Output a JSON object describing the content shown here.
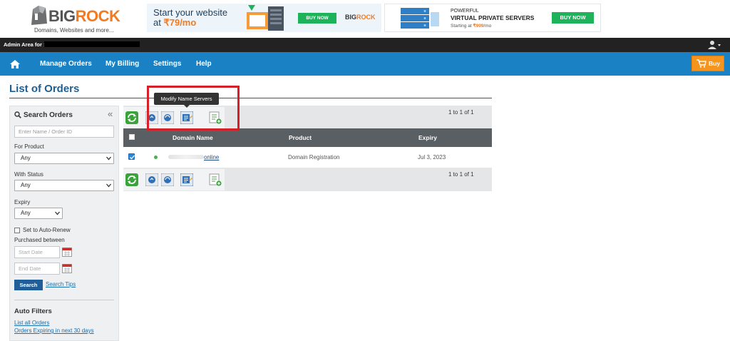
{
  "header": {
    "brand_big": "BIG",
    "brand_rock": "ROCK",
    "tagline": "Domains, Websites and more...",
    "ad1": {
      "line1": "Start your website",
      "line2_prefix": "at ",
      "price": "₹79/mo",
      "button": "BUY NOW",
      "brand_big": "BIG",
      "brand_rock": "ROCK"
    },
    "ad2": {
      "line1": "POWERFUL",
      "line2": "VIRTUAL PRIVATE SERVERS",
      "line3_prefix": "Starting at ",
      "price": "₹999",
      "line3_suffix": "/mo",
      "button": "BUY NOW"
    }
  },
  "admin_bar": {
    "label": "Admin Area for :"
  },
  "nav": {
    "items": [
      "Manage Orders",
      "My Billing",
      "Settings",
      "Help"
    ],
    "buy_label": "Buy"
  },
  "page": {
    "title": "List of Orders"
  },
  "sidebar": {
    "title": "Search Orders",
    "collapse": "«",
    "search_placeholder": "Enter Name / Order ID",
    "for_product_label": "For Product",
    "for_product_value": "Any",
    "with_status_label": "With Status",
    "with_status_value": "Any",
    "expiry_label": "Expiry",
    "expiry_value": "Any",
    "auto_renew_label": "Set to Auto-Renew",
    "purchased_between_label": "Purchased between",
    "start_date_placeholder": "Start Date",
    "end_date_placeholder": "End Date",
    "search_button": "Search",
    "search_tips": "Search Tips",
    "auto_filters_title": "Auto Filters",
    "auto_filters": [
      "List all Orders",
      "Orders Expiring in next 30 days"
    ]
  },
  "orders": {
    "pager_text": "1 to 1 of 1",
    "columns": [
      "Domain Name",
      "Product",
      "Expiry"
    ],
    "rows": [
      {
        "domain_visible": "online",
        "product": "Domain Registration",
        "expiry": "Jul 3, 2023",
        "selected": true
      }
    ],
    "tooltip": "Modify Name Servers"
  },
  "colors": {
    "nav_blue": "#1a82c4",
    "title_blue": "#1d5f92",
    "buy_orange": "#f7941d",
    "highlight_red": "#d52028",
    "buy_now_green": "#1eb35a"
  },
  "icons": {
    "toolbar": [
      "refresh-icon",
      "renew-icon",
      "transfer-icon",
      "modify-name-servers-icon",
      "add-order-icon"
    ]
  }
}
